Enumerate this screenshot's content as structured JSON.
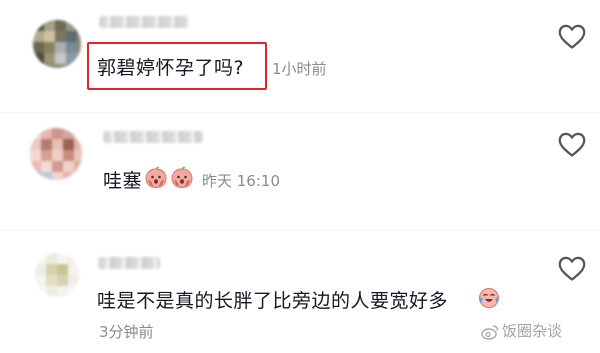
{
  "comments": [
    {
      "text": "郭碧婷怀孕了吗?",
      "time": "1小时前",
      "highlighted": true,
      "highlight_color": "#e0262d",
      "emojis": []
    },
    {
      "text": "哇塞",
      "time": "昨天 16:10",
      "highlighted": false,
      "emojis": [
        "peach-fear-icon",
        "peach-fear-icon"
      ]
    },
    {
      "text": "哇是不是真的长胖了比旁边的人要宽好多",
      "time": "3分钟前",
      "highlighted": false,
      "emojis": [
        "laughing-crying-icon"
      ]
    }
  ],
  "watermark": {
    "text": "饭圈杂谈",
    "icon": "weibo-logo-icon"
  },
  "colors": {
    "heart_stroke": "#555555",
    "time_text": "#8a8b91"
  }
}
